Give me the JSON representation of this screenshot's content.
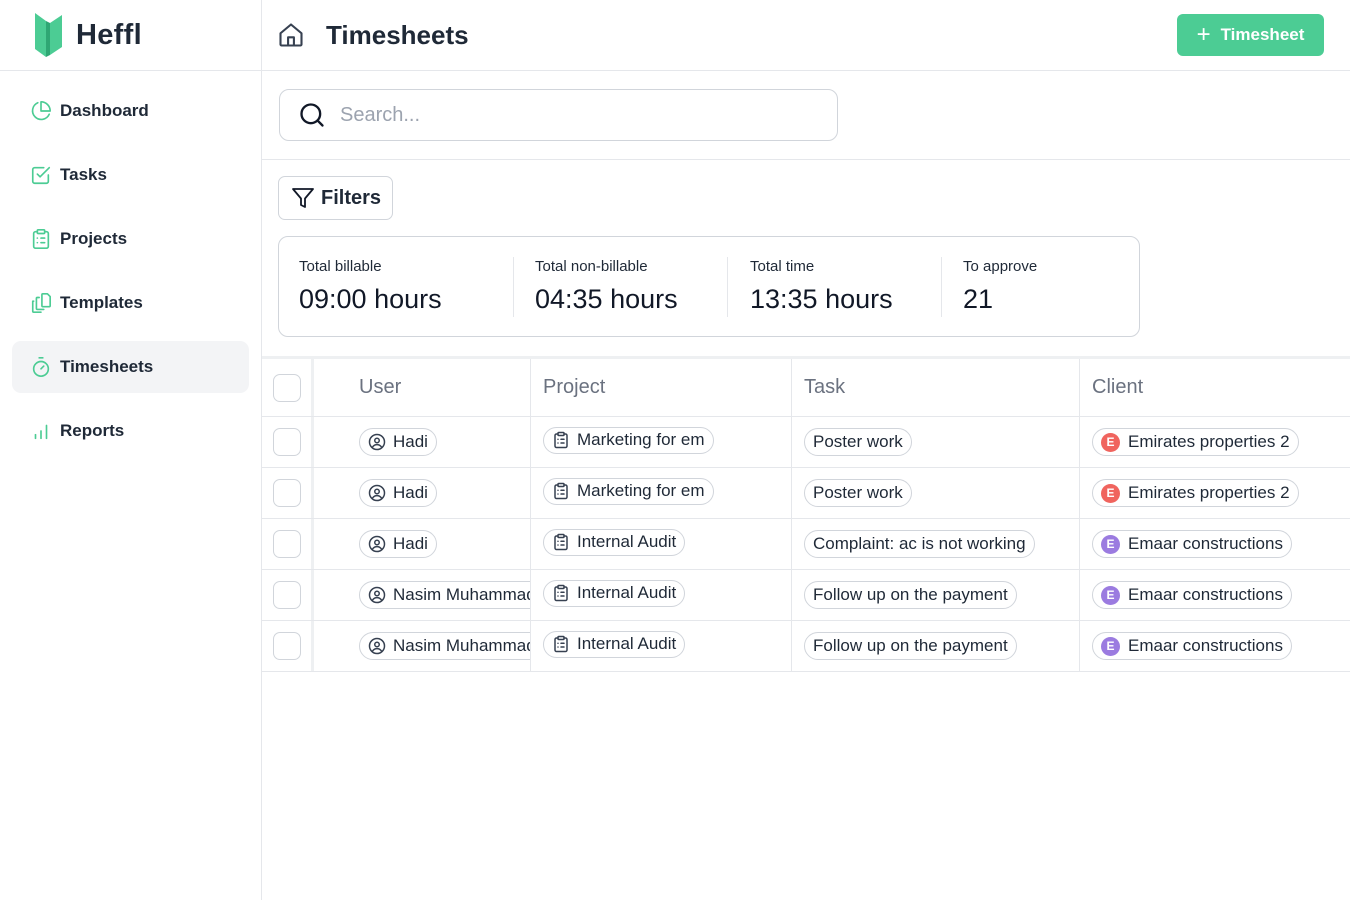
{
  "brand": {
    "name": "Heffl",
    "accent": "#4ccc94"
  },
  "sidebar": {
    "items": [
      {
        "label": "Dashboard",
        "icon": "pie-chart-icon",
        "active": false
      },
      {
        "label": "Tasks",
        "icon": "check-square-icon",
        "active": false
      },
      {
        "label": "Projects",
        "icon": "clipboard-list-icon",
        "active": false
      },
      {
        "label": "Templates",
        "icon": "copy-files-icon",
        "active": false
      },
      {
        "label": "Timesheets",
        "icon": "timer-icon",
        "active": true
      },
      {
        "label": "Reports",
        "icon": "bar-chart-icon",
        "active": false
      }
    ]
  },
  "header": {
    "title": "Timesheets",
    "add_button_label": "Timesheet",
    "home_icon": "home-icon"
  },
  "search": {
    "placeholder": "Search...",
    "value": ""
  },
  "filters": {
    "label": "Filters"
  },
  "stats": [
    {
      "label": "Total billable",
      "value": "09:00 hours"
    },
    {
      "label": "Total non-billable",
      "value": "04:35 hours"
    },
    {
      "label": "Total time",
      "value": "13:35 hours"
    },
    {
      "label": "To approve",
      "value": "21"
    }
  ],
  "table": {
    "columns": [
      "User",
      "Project",
      "Task",
      "Client"
    ],
    "rows": [
      {
        "user": "Hadi",
        "project": "Marketing for em",
        "task": "Poster work",
        "client": "Emirates properties 2",
        "client_initial": "E",
        "client_color": "#f0645e"
      },
      {
        "user": "Hadi",
        "project": "Marketing for em",
        "task": "Poster work",
        "client": "Emirates properties 2",
        "client_initial": "E",
        "client_color": "#f0645e"
      },
      {
        "user": "Hadi",
        "project": "Internal Audit",
        "task": "Complaint: ac is not working",
        "client": "Emaar constructions",
        "client_initial": "E",
        "client_color": "#9b7be0"
      },
      {
        "user": "Nasim Muhammad",
        "project": "Internal Audit",
        "task": "Follow up on the payment",
        "client": "Emaar constructions",
        "client_initial": "E",
        "client_color": "#9b7be0"
      },
      {
        "user": "Nasim Muhammad",
        "project": "Internal Audit",
        "task": "Follow up on the payment",
        "client": "Emaar constructions",
        "client_initial": "E",
        "client_color": "#9b7be0"
      }
    ]
  }
}
